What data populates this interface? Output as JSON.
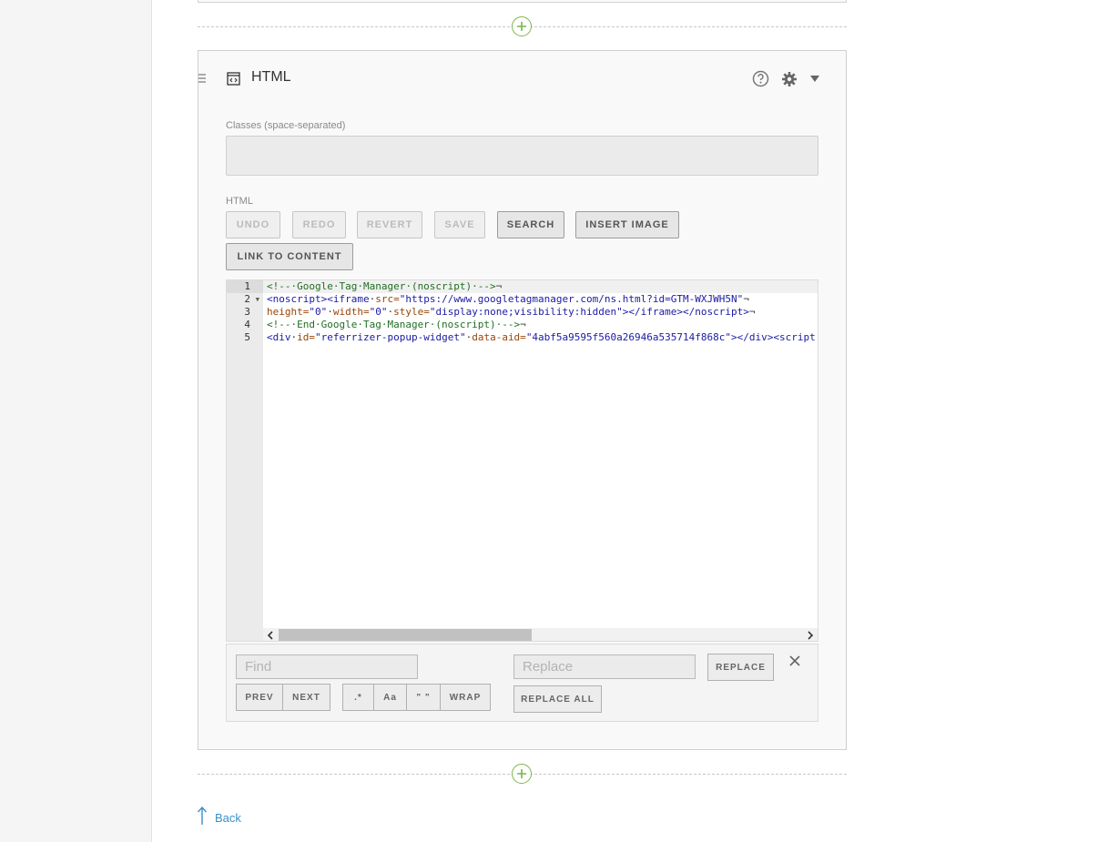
{
  "block": {
    "title": "HTML",
    "classes_label": "Classes (space-separated)",
    "classes_value": "",
    "html_label": "HTML"
  },
  "toolbar": {
    "undo": "UNDO",
    "redo": "REDO",
    "revert": "REVERT",
    "save": "SAVE",
    "search": "SEARCH",
    "insert_image": "INSERT IMAGE",
    "link_to_content": "LINK TO CONTENT"
  },
  "editor": {
    "line_numbers": [
      "1",
      "2",
      "3",
      "4",
      "5"
    ],
    "lines": [
      [
        {
          "cls": "c-comment",
          "text": "<!--·Google·Tag·Manager·(noscript)·-->"
        },
        {
          "cls": "c-plain",
          "text": "¬"
        }
      ],
      [
        {
          "cls": "c-tag",
          "text": "<noscript><iframe"
        },
        {
          "cls": "c-plain",
          "text": "·"
        },
        {
          "cls": "c-attr",
          "text": "src="
        },
        {
          "cls": "c-str",
          "text": "\"https://www.googletagmanager.com/ns.html?id=GTM-WXJWH5N\""
        },
        {
          "cls": "c-plain",
          "text": "¬"
        }
      ],
      [
        {
          "cls": "c-attr",
          "text": "height="
        },
        {
          "cls": "c-str",
          "text": "\"0\""
        },
        {
          "cls": "c-plain",
          "text": "·"
        },
        {
          "cls": "c-attr",
          "text": "width="
        },
        {
          "cls": "c-str",
          "text": "\"0\""
        },
        {
          "cls": "c-plain",
          "text": "·"
        },
        {
          "cls": "c-attr",
          "text": "style="
        },
        {
          "cls": "c-str",
          "text": "\"display:none;visibility:hidden\""
        },
        {
          "cls": "c-tag",
          "text": "></iframe></noscript>"
        },
        {
          "cls": "c-plain",
          "text": "¬"
        }
      ],
      [
        {
          "cls": "c-comment",
          "text": "<!--·End·Google·Tag·Manager·(noscript)·-->"
        },
        {
          "cls": "c-plain",
          "text": "¬"
        }
      ],
      [
        {
          "cls": "c-tag",
          "text": "<div"
        },
        {
          "cls": "c-plain",
          "text": "·"
        },
        {
          "cls": "c-attr",
          "text": "id="
        },
        {
          "cls": "c-str",
          "text": "\"referrizer-popup-widget\""
        },
        {
          "cls": "c-plain",
          "text": "·"
        },
        {
          "cls": "c-attr",
          "text": "data-aid="
        },
        {
          "cls": "c-str",
          "text": "\"4abf5a9595f560a26946a535714f868c\""
        },
        {
          "cls": "c-tag",
          "text": "></div><script"
        }
      ]
    ]
  },
  "search_panel": {
    "find_placeholder": "Find",
    "replace_placeholder": "Replace",
    "replace": "REPLACE",
    "replace_all": "REPLACE ALL",
    "prev": "PREV",
    "next": "NEXT",
    "regex": ".*",
    "case": "Aa",
    "whole_word": "\" \"",
    "wrap": "WRAP"
  },
  "footer": {
    "back": "Back"
  },
  "colors": {
    "accent_green": "#7ab648",
    "link_blue": "#3a8fc7"
  },
  "icons": [
    "plus-circle-icon",
    "drag-handle-icon",
    "html-block-icon",
    "help-icon",
    "gear-icon",
    "caret-down-icon",
    "chevron-left-icon",
    "chevron-right-icon",
    "close-icon",
    "arrow-up-icon"
  ]
}
